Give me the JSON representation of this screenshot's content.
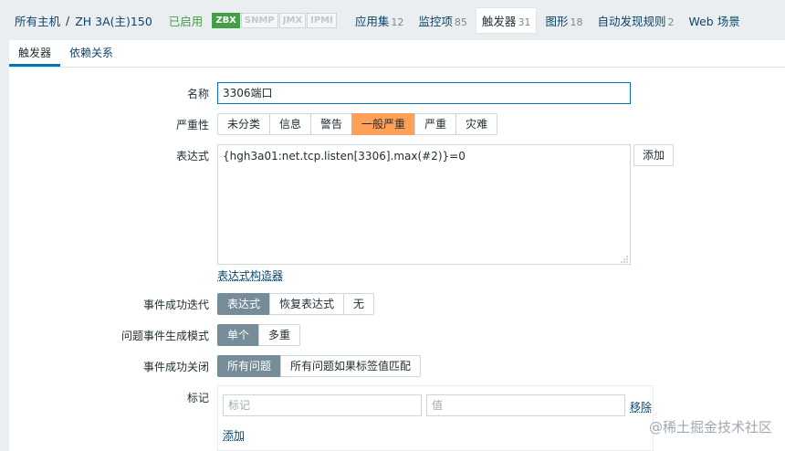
{
  "breadcrumb": {
    "all_hosts": "所有主机",
    "separator": "/",
    "host": "ZH 3A(主)150",
    "status": "已启用"
  },
  "badges": [
    {
      "label": "ZBX",
      "active": true
    },
    {
      "label": "SNMP",
      "active": false
    },
    {
      "label": "JMX",
      "active": false
    },
    {
      "label": "IPMI",
      "active": false
    }
  ],
  "nav": [
    {
      "label": "应用集",
      "count": "12"
    },
    {
      "label": "监控项",
      "count": "85"
    },
    {
      "label": "触发器",
      "count": "31"
    },
    {
      "label": "图形",
      "count": "18"
    },
    {
      "label": "自动发现规则",
      "count": "2"
    },
    {
      "label": "Web 场景",
      "count": ""
    }
  ],
  "tabs": [
    "触发器",
    "依赖关系"
  ],
  "form": {
    "name_label": "名称",
    "name_value": "3306端口",
    "severity_label": "严重性",
    "severity_options": [
      "未分类",
      "信息",
      "警告",
      "一般严重",
      "严重",
      "灾难"
    ],
    "severity_selected": "一般严重",
    "expression_label": "表达式",
    "expression_value": "{hgh3a01:net.tcp.listen[3306].max(#2)}=0",
    "add_button": "添加",
    "expression_builder": "表达式构造器",
    "ok_event_label": "事件成功迭代",
    "ok_event_options": [
      "表达式",
      "恢复表达式",
      "无"
    ],
    "problem_mode_label": "问题事件生成模式",
    "problem_mode_options": [
      "单个",
      "多重"
    ],
    "ok_close_label": "事件成功关闭",
    "ok_close_options": [
      "所有问题",
      "所有问题如果标签值匹配"
    ],
    "tags_label": "标记",
    "tag_placeholder": "标记",
    "value_placeholder": "值",
    "remove_link": "移除",
    "add_link": "添加"
  },
  "watermark": "@稀土掘金技术社区",
  "colors": {
    "link": "#0a466a",
    "enabled_green": "#429e47",
    "selected_gray": "#768d99",
    "selected_orange": "#ffa059",
    "focus_blue": "#0275b8"
  }
}
